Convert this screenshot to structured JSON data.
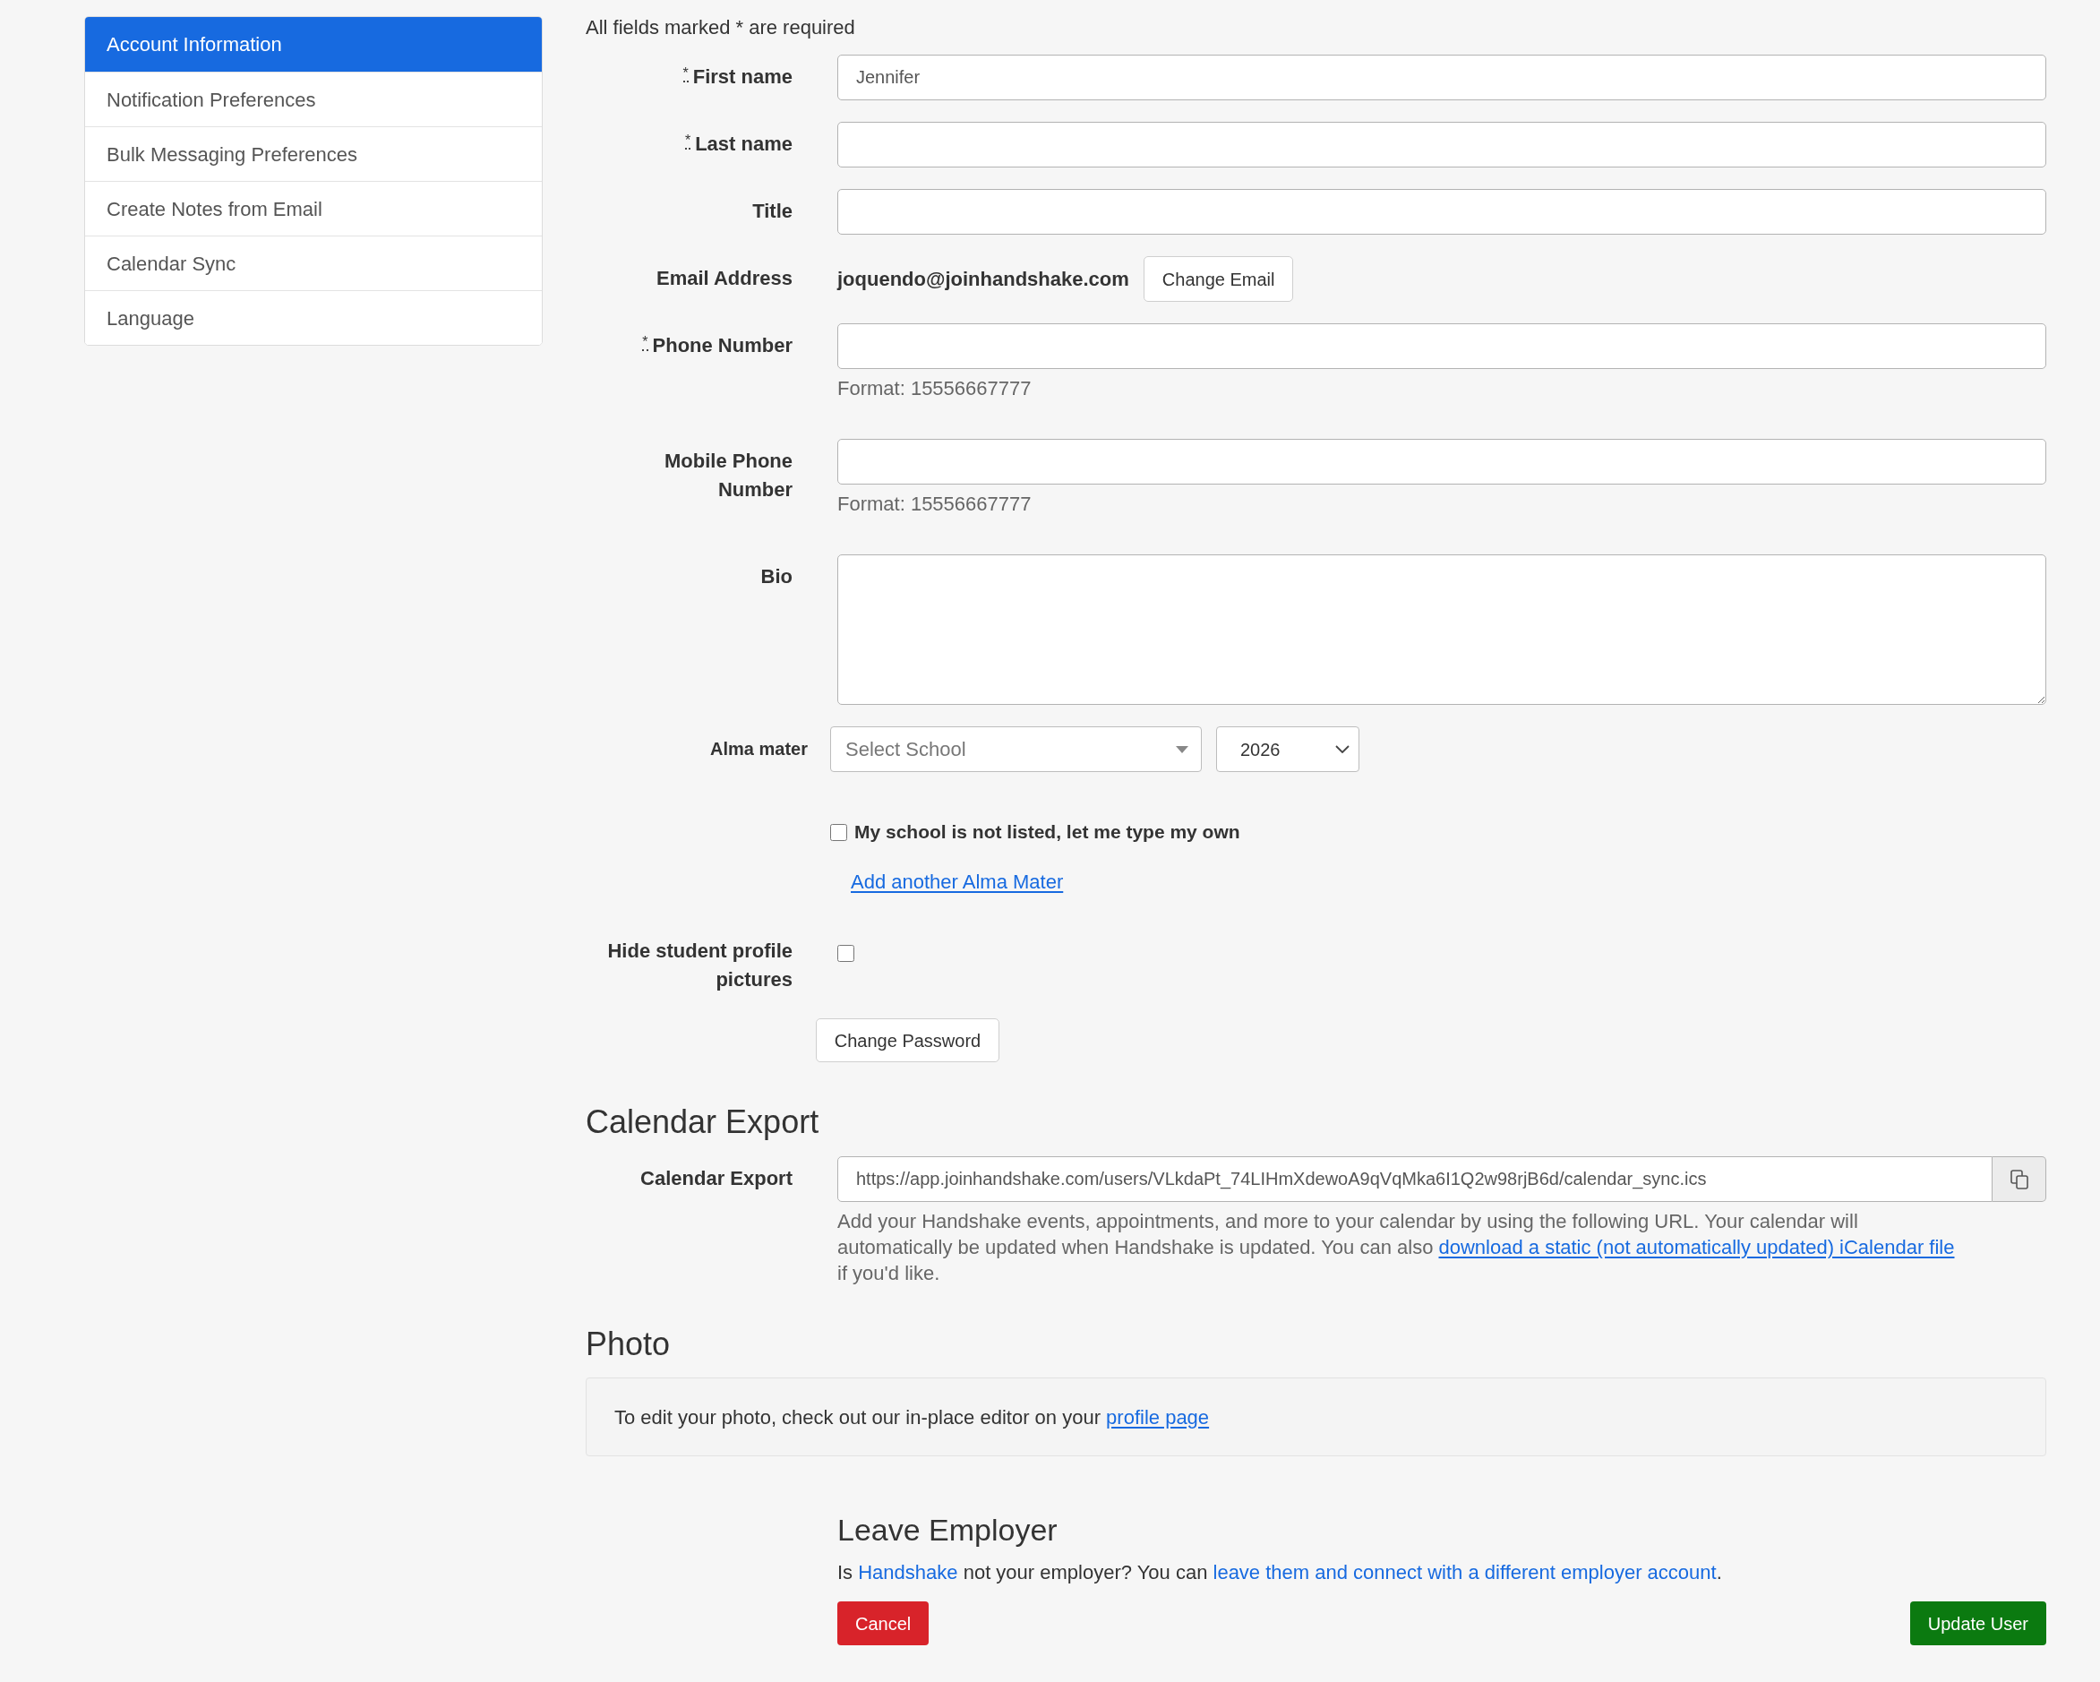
{
  "sidebar": {
    "items": [
      {
        "label": "Account Information",
        "selected": true
      },
      {
        "label": "Notification Preferences",
        "selected": false
      },
      {
        "label": "Bulk Messaging Preferences",
        "selected": false
      },
      {
        "label": "Create Notes from Email",
        "selected": false
      },
      {
        "label": "Calendar Sync",
        "selected": false
      },
      {
        "label": "Language",
        "selected": false
      }
    ]
  },
  "required_note": "All fields marked * are required",
  "fields": [
    {
      "kind": "input",
      "marker": "*",
      "label": "First name",
      "value": "Jennifer"
    },
    {
      "kind": "input",
      "marker": "*",
      "label": "Last name"
    },
    {
      "kind": "input",
      "label": "Title"
    },
    {
      "kind": "email",
      "label": "Email Address",
      "value": "joquendo@joinhandshake.com",
      "button": "Change Email"
    },
    {
      "kind": "input",
      "marker": "*",
      "label": "Phone Number",
      "help": "Format: 15556667777"
    },
    {
      "kind": "input",
      "label": "Mobile Phone Number",
      "help": "Format: 15556667777"
    },
    {
      "kind": "textarea",
      "label": "Bio"
    }
  ],
  "alma_mater": {
    "label": "Alma mater",
    "school_select": {
      "placeholder": "Select School"
    },
    "year_select": {
      "value": "2026"
    },
    "not_listed": {
      "label": "My school is not listed, let me type my own",
      "checked": false
    },
    "add_link": "Add another Alma Mater"
  },
  "hide_pictures": {
    "label": "Hide student profile pictures",
    "checked": false
  },
  "change_password": "Change Password",
  "calendar_export": {
    "heading": "Calendar Export",
    "label": "Calendar Export",
    "url": "https://app.joinhandshake.com/users/VLkdaPt_74LIHmXdewoA9qVqMka6I1Q2w98rjB6d/calendar_sync.ics",
    "description": [
      {
        "kind": "text",
        "text": "Add your Handshake events, appointments, and more to your calendar by using the following URL. Your calendar will automatically be updated when Handshake is updated. You can also "
      },
      {
        "kind": "link",
        "text": "download a static (not automatically updated) iCalendar file"
      },
      {
        "kind": "text",
        "text": " if you'd like."
      }
    ]
  },
  "photo": {
    "heading": "Photo",
    "note": [
      {
        "kind": "text",
        "text": "To edit your photo, check out our in-place editor on your "
      },
      {
        "kind": "link",
        "text": "profile page"
      }
    ]
  },
  "leave_employer": {
    "heading": "Leave Employer",
    "text": [
      {
        "kind": "text",
        "text": "Is "
      },
      {
        "kind": "link",
        "text": "Handshake"
      },
      {
        "kind": "text",
        "text": " not your employer? You can "
      },
      {
        "kind": "link",
        "text": "leave them and connect with a different employer account"
      },
      {
        "kind": "text",
        "text": "."
      }
    ]
  },
  "actions": [
    {
      "kind": "danger",
      "label": "Cancel"
    },
    {
      "kind": "success",
      "label": "Update User"
    }
  ]
}
